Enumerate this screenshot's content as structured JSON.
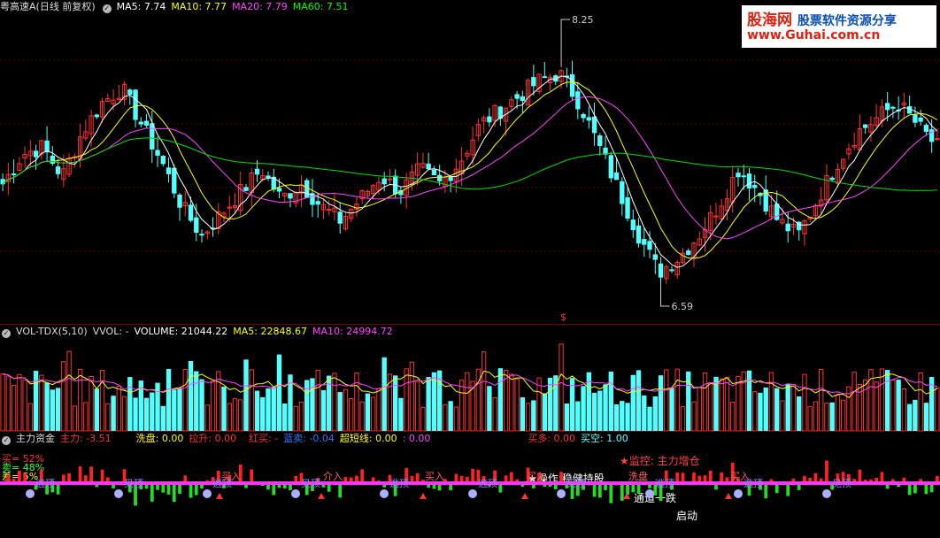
{
  "price_header": {
    "title": "粤高速A",
    "period": "(日线 前复权)",
    "ma5": "MA5: 7.74",
    "ma10": "MA10: 7.77",
    "ma20": "MA20: 7.79",
    "ma60": "MA60: 7.51",
    "colors": {
      "ma5": "#ffffff",
      "ma10": "#ffff00",
      "ma20": "#ff00ff",
      "ma60": "#00ff00"
    }
  },
  "watermark": {
    "brand_a": "股海网",
    "brand_b": "股票软件资源分享",
    "url": "www.Guhai.com.cn"
  },
  "volume_header": {
    "name": "VOL-TDX(5,10)",
    "vvol": "VVOL: -",
    "volume": "VOLUME: 21044.22",
    "ma5": "MA5: 22848.67",
    "ma10": "MA10: 24994.72"
  },
  "indicator_header": {
    "name": "主力资金",
    "zhuli": "主力: -3.51",
    "xipan": "洗盘: 0.00",
    "lasheng": "拉升: 0.00",
    "hongmai": "红买: -",
    "lanmai": "蓝卖: -0.04",
    "chaoduan": "超短线: 0.00",
    "colon": ": 0.00",
    "maiduo": "买多: 0.00",
    "maikong": "买空: 1.00"
  },
  "indicator_labels": {
    "mai": "买= 52%",
    "mai2": "卖= 48%",
    "cha": "差= 5%",
    "jiankong": "★监控: 主力增仓",
    "qidong": "启动",
    "tongbuy": "通道一跌",
    "note": "★操作:稳健持股",
    "signals": [
      "逃顶",
      "见顶",
      "逃顶",
      "见顶",
      "逃顶",
      "逃顶",
      "见顶",
      "逃顶",
      "逃顶",
      "见顶"
    ],
    "buy_signals": [
      "买入",
      "介入",
      "买入",
      "买入",
      "洗盘",
      "买入"
    ]
  },
  "chart_data": [
    {
      "type": "candlestick",
      "title": "粤高速A",
      "annotations": {
        "high": "8.25",
        "low": "6.59",
        "marker": "$"
      },
      "ylim": [
        6.4,
        8.5
      ],
      "series_names": [
        "MA5",
        "MA10",
        "MA20",
        "MA60"
      ],
      "candles_sampled": [
        [
          7.15,
          7.35
        ],
        [
          7.3,
          7.55
        ],
        [
          7.5,
          7.6
        ],
        [
          7.55,
          7.4
        ],
        [
          7.4,
          7.7
        ],
        [
          7.6,
          7.9
        ],
        [
          7.9,
          8.0
        ],
        [
          7.95,
          7.75
        ],
        [
          7.7,
          7.5
        ],
        [
          7.45,
          7.2
        ],
        [
          7.2,
          7.0
        ],
        [
          6.95,
          7.15
        ],
        [
          7.1,
          7.3
        ],
        [
          7.3,
          7.45
        ],
        [
          7.4,
          7.25
        ],
        [
          7.2,
          7.35
        ],
        [
          7.3,
          7.2
        ],
        [
          7.2,
          7.1
        ],
        [
          7.05,
          7.25
        ],
        [
          7.2,
          7.4
        ],
        [
          7.35,
          7.3
        ],
        [
          7.3,
          7.45
        ],
        [
          7.4,
          7.35
        ],
        [
          7.35,
          7.5
        ],
        [
          7.5,
          7.75
        ],
        [
          7.7,
          7.85
        ],
        [
          7.85,
          7.95
        ],
        [
          7.9,
          8.05
        ],
        [
          8.0,
          8.1
        ],
        [
          8.05,
          7.9
        ],
        [
          7.85,
          7.6
        ],
        [
          7.55,
          7.3
        ],
        [
          7.3,
          7.0
        ],
        [
          6.95,
          6.75
        ],
        [
          6.7,
          6.85
        ],
        [
          6.8,
          7.0
        ],
        [
          7.0,
          7.2
        ],
        [
          7.2,
          7.45
        ],
        [
          7.4,
          7.3
        ],
        [
          7.3,
          7.1
        ],
        [
          7.1,
          7.0
        ],
        [
          7.0,
          7.25
        ],
        [
          7.3,
          7.5
        ],
        [
          7.5,
          7.7
        ],
        [
          7.7,
          7.8
        ],
        [
          7.8,
          7.9
        ],
        [
          7.85,
          7.75
        ],
        [
          7.7,
          7.6
        ]
      ]
    },
    {
      "type": "bar",
      "title": "VOL-TDX(5,10)",
      "series": [
        {
          "name": "VOLUME",
          "values_sampled": [
            21044.22
          ]
        },
        {
          "name": "MA5",
          "values_sampled": [
            22848.67
          ]
        },
        {
          "name": "MA10",
          "values_sampled": [
            24994.72
          ]
        }
      ]
    }
  ]
}
